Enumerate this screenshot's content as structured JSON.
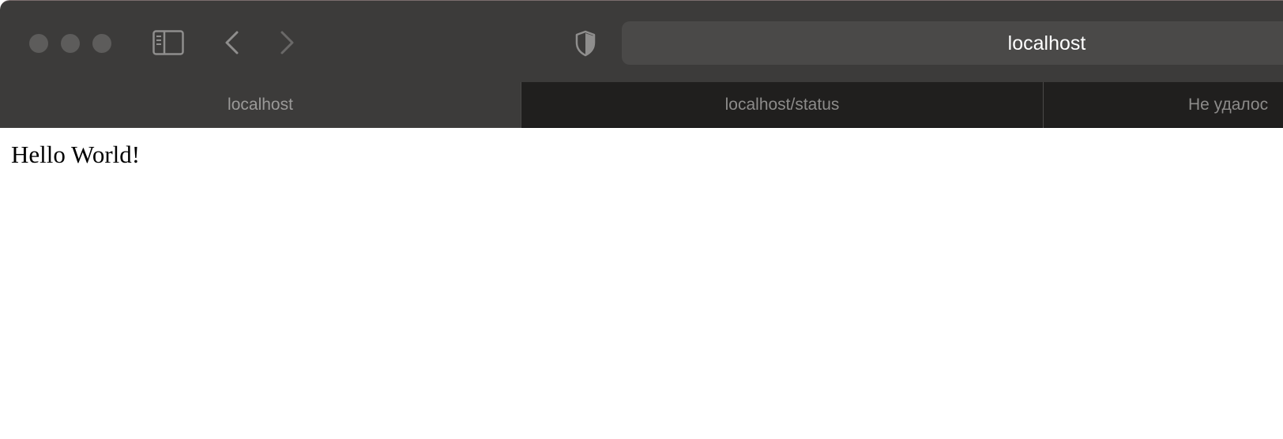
{
  "window": {
    "controls": [
      "close",
      "minimize",
      "zoom"
    ]
  },
  "toolbar": {
    "sidebar_icon": "sidebar-icon",
    "back_icon": "chevron-left-icon",
    "forward_icon": "chevron-right-icon",
    "privacy_icon": "shield-icon",
    "address": "localhost"
  },
  "tabs": [
    {
      "label": "localhost",
      "active": true
    },
    {
      "label": "localhost/status",
      "active": false
    },
    {
      "label": "Не удалос",
      "active": false
    }
  ],
  "page": {
    "text": "Hello World!"
  },
  "colors": {
    "toolbar_bg": "#3c3b3a",
    "tabbar_bg": "#201f1e",
    "url_field_bg": "#4a4948",
    "control_gray": "#5d5c5b"
  }
}
